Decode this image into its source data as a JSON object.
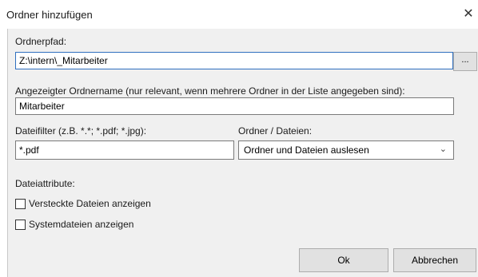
{
  "window": {
    "title": "Ordner hinzufügen",
    "close_glyph": "✕"
  },
  "folder_path": {
    "label": "Ordnerpfad:",
    "value": "Z:\\intern\\_Mitarbeiter",
    "browse_label": "..."
  },
  "display_name": {
    "label": "Angezeigter Ordnername (nur relevant, wenn mehrere Ordner in der Liste angegeben sind):",
    "value": "Mitarbeiter"
  },
  "file_filter": {
    "label": "Dateifilter (z.B. *.*; *.pdf; *.jpg):",
    "value": "*.pdf"
  },
  "folder_files": {
    "label": "Ordner / Dateien:",
    "selected": "Ordner und Dateien auslesen",
    "chevron": "⌄"
  },
  "attributes": {
    "label": "Dateiattribute:",
    "options": [
      {
        "label": "Versteckte Dateien anzeigen",
        "checked": false
      },
      {
        "label": "Systemdateien anzeigen",
        "checked": false
      }
    ]
  },
  "buttons": {
    "ok": "Ok",
    "cancel": "Abbrechen"
  }
}
